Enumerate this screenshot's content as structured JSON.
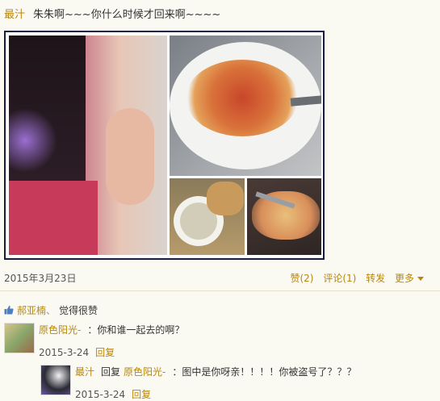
{
  "post": {
    "author": "最汁",
    "text": "朱朱啊~~~你什么时候才回来啊~~~~",
    "date": "2015年3月23日",
    "actions": {
      "like": "赞(2)",
      "comment": "评论(1)",
      "repost": "转发",
      "more": "更多"
    }
  },
  "likes": {
    "icon": "thumbs-up-icon",
    "users": [
      "郝亚楠"
    ],
    "separator": "、",
    "suffix": "觉得很赞"
  },
  "comments": [
    {
      "user": "原色阳光-",
      "text": "：你和谁一起去的啊？",
      "date": "2015-3-24",
      "reply_label": "回复"
    }
  ],
  "replies": [
    {
      "user": "最汁",
      "reply_word": "回复",
      "target": "原色阳光-",
      "text": "：图中是你呀亲！！！！你被盗号了？？？",
      "date": "2015-3-24",
      "reply_label": "回复"
    }
  ],
  "colors": {
    "link": "#b8860b",
    "background": "#fbfaf2",
    "frame": "#1a1a40"
  }
}
